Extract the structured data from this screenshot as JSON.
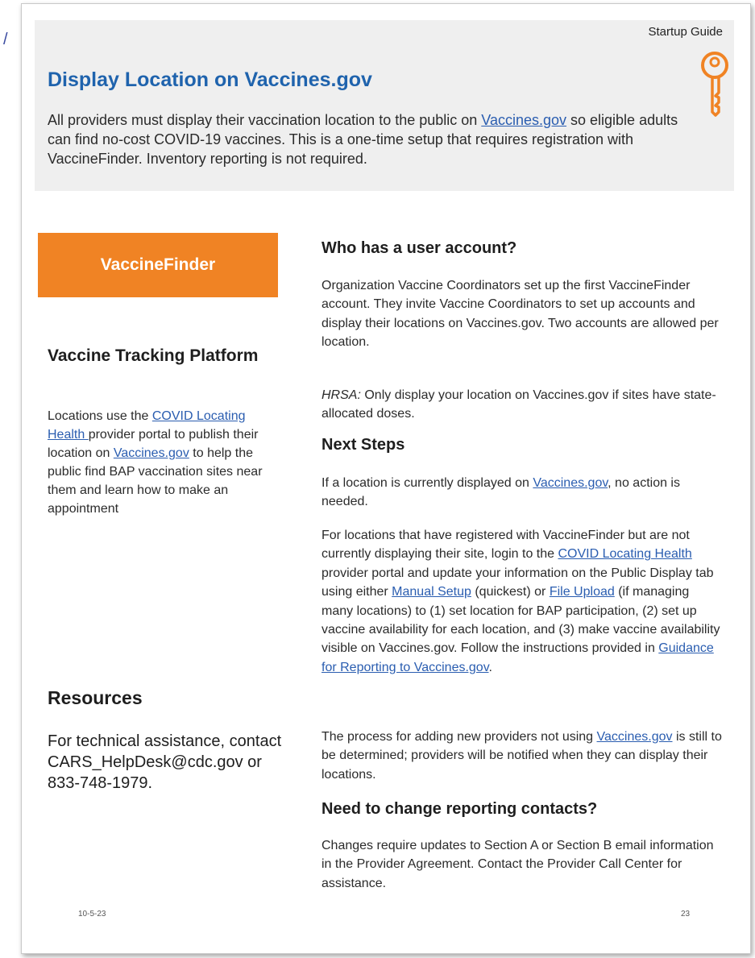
{
  "header": {
    "startup_guide": "Startup Guide",
    "title": "Display Location on Vaccines.gov",
    "intro_1": "All providers must display their vaccination location to the public on ",
    "intro_link": "Vaccines.gov",
    "intro_2": " so eligible adults can find no-cost COVID-19 vaccines. This is a one-time setup that requires registration with VaccineFinder. Inventory reporting is not required."
  },
  "left": {
    "vaccinefinder_label": "VaccineFinder",
    "platform_heading": "Vaccine Tracking Platform",
    "platform_1": "Locations use the ",
    "platform_link_1": "COVID Locating Health ",
    "platform_2": "provider portal to publish their location on ",
    "platform_link_2": "Vaccines.gov",
    "platform_3": " to help the public find BAP vaccination sites near them and learn how to make an appointment",
    "resources_heading": "Resources",
    "resources_text": "For technical assistance, contact CARS_HelpDesk@cdc.gov or 833-748-1979."
  },
  "right": {
    "who_heading": "Who has a user account?",
    "who_text": "Organization Vaccine Coordinators set up the first VaccineFinder account. They invite Vaccine Coordinators to set up accounts and display their locations on Vaccines.gov. Two accounts are allowed per location.",
    "hrsa_label": "HRSA:",
    "hrsa_text": " Only display your location on Vaccines.gov if sites have state-allocated doses.",
    "next_heading": "Next Steps",
    "next_1a": "If a location is currently displayed on ",
    "next_1_link": "Vaccines.gov",
    "next_1b": ", no action is needed.",
    "next_2a": "For locations that have registered with VaccineFinder but are not currently displaying their site, login to the ",
    "next_2_link1": "COVID Locating Health",
    "next_2b": " provider portal and update your information on the Public Display tab using either ",
    "next_2_link2": "Manual Setup",
    "next_2c": " (quickest) or ",
    "next_2_link3": "File Upload",
    "next_2d": " (if managing many locations) to (1) set location for BAP participation, (2) set up vaccine availability for each location, and (3) make vaccine availability visible on Vaccines.gov. Follow the instructions provided in ",
    "next_2_link4": "Guidance for Reporting to Vaccines.gov",
    "next_2e": ".",
    "next_3a": "The process for adding new providers not using ",
    "next_3_link": "Vaccines.gov",
    "next_3b": " is still to be determined; providers will be notified when they can display their locations.",
    "contacts_heading": "Need to change reporting contacts?",
    "contacts_text": "Changes require updates to Section A or Section B email information in the Provider Agreement. Contact the Provider Call Center for assistance."
  },
  "footer": {
    "date": "10-5-23",
    "page_number": "23"
  },
  "colors": {
    "title_blue": "#1f63ad",
    "link_blue": "#2a5db0",
    "orange": "#f08324",
    "band_gray": "#efefef"
  },
  "icons": {
    "key": "key-icon"
  }
}
